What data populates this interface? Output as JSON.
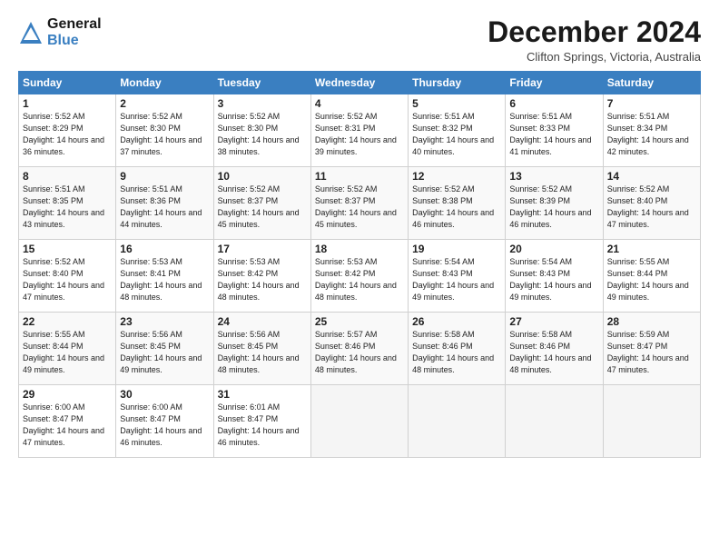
{
  "logo": {
    "line1": "General",
    "line2": "Blue"
  },
  "title": "December 2024",
  "location": "Clifton Springs, Victoria, Australia",
  "days_of_week": [
    "Sunday",
    "Monday",
    "Tuesday",
    "Wednesday",
    "Thursday",
    "Friday",
    "Saturday"
  ],
  "weeks": [
    [
      {
        "day": "1",
        "sunrise": "5:52 AM",
        "sunset": "8:29 PM",
        "daylight": "14 hours and 36 minutes."
      },
      {
        "day": "2",
        "sunrise": "5:52 AM",
        "sunset": "8:30 PM",
        "daylight": "14 hours and 37 minutes."
      },
      {
        "day": "3",
        "sunrise": "5:52 AM",
        "sunset": "8:30 PM",
        "daylight": "14 hours and 38 minutes."
      },
      {
        "day": "4",
        "sunrise": "5:52 AM",
        "sunset": "8:31 PM",
        "daylight": "14 hours and 39 minutes."
      },
      {
        "day": "5",
        "sunrise": "5:51 AM",
        "sunset": "8:32 PM",
        "daylight": "14 hours and 40 minutes."
      },
      {
        "day": "6",
        "sunrise": "5:51 AM",
        "sunset": "8:33 PM",
        "daylight": "14 hours and 41 minutes."
      },
      {
        "day": "7",
        "sunrise": "5:51 AM",
        "sunset": "8:34 PM",
        "daylight": "14 hours and 42 minutes."
      }
    ],
    [
      {
        "day": "8",
        "sunrise": "5:51 AM",
        "sunset": "8:35 PM",
        "daylight": "14 hours and 43 minutes."
      },
      {
        "day": "9",
        "sunrise": "5:51 AM",
        "sunset": "8:36 PM",
        "daylight": "14 hours and 44 minutes."
      },
      {
        "day": "10",
        "sunrise": "5:52 AM",
        "sunset": "8:37 PM",
        "daylight": "14 hours and 45 minutes."
      },
      {
        "day": "11",
        "sunrise": "5:52 AM",
        "sunset": "8:37 PM",
        "daylight": "14 hours and 45 minutes."
      },
      {
        "day": "12",
        "sunrise": "5:52 AM",
        "sunset": "8:38 PM",
        "daylight": "14 hours and 46 minutes."
      },
      {
        "day": "13",
        "sunrise": "5:52 AM",
        "sunset": "8:39 PM",
        "daylight": "14 hours and 46 minutes."
      },
      {
        "day": "14",
        "sunrise": "5:52 AM",
        "sunset": "8:40 PM",
        "daylight": "14 hours and 47 minutes."
      }
    ],
    [
      {
        "day": "15",
        "sunrise": "5:52 AM",
        "sunset": "8:40 PM",
        "daylight": "14 hours and 47 minutes."
      },
      {
        "day": "16",
        "sunrise": "5:53 AM",
        "sunset": "8:41 PM",
        "daylight": "14 hours and 48 minutes."
      },
      {
        "day": "17",
        "sunrise": "5:53 AM",
        "sunset": "8:42 PM",
        "daylight": "14 hours and 48 minutes."
      },
      {
        "day": "18",
        "sunrise": "5:53 AM",
        "sunset": "8:42 PM",
        "daylight": "14 hours and 48 minutes."
      },
      {
        "day": "19",
        "sunrise": "5:54 AM",
        "sunset": "8:43 PM",
        "daylight": "14 hours and 49 minutes."
      },
      {
        "day": "20",
        "sunrise": "5:54 AM",
        "sunset": "8:43 PM",
        "daylight": "14 hours and 49 minutes."
      },
      {
        "day": "21",
        "sunrise": "5:55 AM",
        "sunset": "8:44 PM",
        "daylight": "14 hours and 49 minutes."
      }
    ],
    [
      {
        "day": "22",
        "sunrise": "5:55 AM",
        "sunset": "8:44 PM",
        "daylight": "14 hours and 49 minutes."
      },
      {
        "day": "23",
        "sunrise": "5:56 AM",
        "sunset": "8:45 PM",
        "daylight": "14 hours and 49 minutes."
      },
      {
        "day": "24",
        "sunrise": "5:56 AM",
        "sunset": "8:45 PM",
        "daylight": "14 hours and 48 minutes."
      },
      {
        "day": "25",
        "sunrise": "5:57 AM",
        "sunset": "8:46 PM",
        "daylight": "14 hours and 48 minutes."
      },
      {
        "day": "26",
        "sunrise": "5:58 AM",
        "sunset": "8:46 PM",
        "daylight": "14 hours and 48 minutes."
      },
      {
        "day": "27",
        "sunrise": "5:58 AM",
        "sunset": "8:46 PM",
        "daylight": "14 hours and 48 minutes."
      },
      {
        "day": "28",
        "sunrise": "5:59 AM",
        "sunset": "8:47 PM",
        "daylight": "14 hours and 47 minutes."
      }
    ],
    [
      {
        "day": "29",
        "sunrise": "6:00 AM",
        "sunset": "8:47 PM",
        "daylight": "14 hours and 47 minutes."
      },
      {
        "day": "30",
        "sunrise": "6:00 AM",
        "sunset": "8:47 PM",
        "daylight": "14 hours and 46 minutes."
      },
      {
        "day": "31",
        "sunrise": "6:01 AM",
        "sunset": "8:47 PM",
        "daylight": "14 hours and 46 minutes."
      },
      null,
      null,
      null,
      null
    ]
  ]
}
